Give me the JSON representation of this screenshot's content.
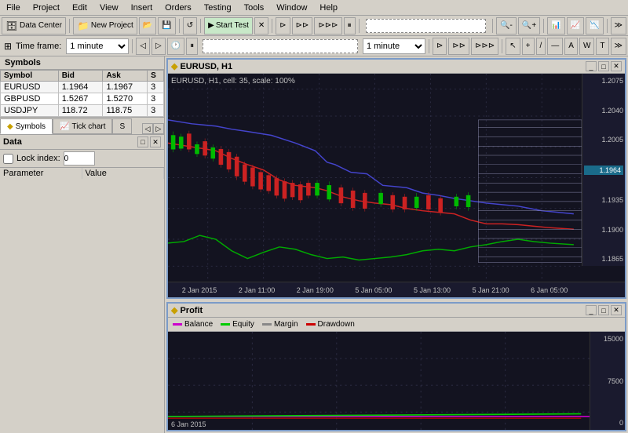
{
  "menubar": {
    "items": [
      "File",
      "Project",
      "Edit",
      "View",
      "Insert",
      "Orders",
      "Testing",
      "Tools",
      "Window",
      "Help"
    ]
  },
  "toolbar1": {
    "datacenter_label": "Data Center",
    "newproject_label": "New Project",
    "starttest_label": "Start Test"
  },
  "toolbar2": {
    "timeframe_label": "Time frame:",
    "timeframe_value": "1 minute",
    "timeframe2_value": "1 minute"
  },
  "symbols_panel": {
    "title": "Symbols",
    "columns": [
      "Symbol",
      "Bid",
      "Ask",
      "S"
    ],
    "rows": [
      {
        "symbol": "EURUSD",
        "bid": "1.1964",
        "ask": "1.1967",
        "s": "3"
      },
      {
        "symbol": "GBPUSD",
        "bid": "1.5267",
        "ask": "1.5270",
        "s": "3"
      },
      {
        "symbol": "USDJPY",
        "bid": "118.72",
        "ask": "118.75",
        "s": "3"
      }
    ]
  },
  "tabs": [
    {
      "label": "Symbols",
      "icon": "◆",
      "active": true
    },
    {
      "label": "Tick chart",
      "icon": "📈",
      "active": false
    },
    {
      "label": "S",
      "icon": "",
      "active": false
    }
  ],
  "data_panel": {
    "title": "Data",
    "lock_label": "Lock index:",
    "lock_value": "0",
    "col_param": "Parameter",
    "col_value": "Value"
  },
  "chart_main": {
    "title": "EURUSD, H1",
    "icon": "◆",
    "info_text": "EURUSD, H1, cell: 35, scale: 100%",
    "price_labels": [
      "1.2075",
      "1.2040",
      "1.2005",
      "1.1964",
      "1.1935",
      "1.1900",
      "1.1865"
    ],
    "current_price": "1.1964",
    "time_labels": [
      "2 Jan 2015",
      "2 Jan 11:00",
      "2 Jan 19:00",
      "5 Jan 05:00",
      "5 Jan 13:00",
      "5 Jan 21:00",
      "6 Jan 05:00"
    ],
    "window_btns": [
      "_",
      "□",
      "✕"
    ]
  },
  "profit_panel": {
    "title": "Profit",
    "icon": "◆",
    "legend": [
      {
        "label": "Balance",
        "color": "#cc00cc"
      },
      {
        "label": "Equity",
        "color": "#00cc00"
      },
      {
        "label": "Margin",
        "color": "#888888"
      },
      {
        "label": "Drawdown",
        "color": "#cc0000"
      }
    ],
    "price_labels": [
      "15000",
      "7500",
      "0"
    ],
    "time_label": "6 Jan 2015",
    "window_btns": [
      "_",
      "□",
      "✕"
    ]
  }
}
